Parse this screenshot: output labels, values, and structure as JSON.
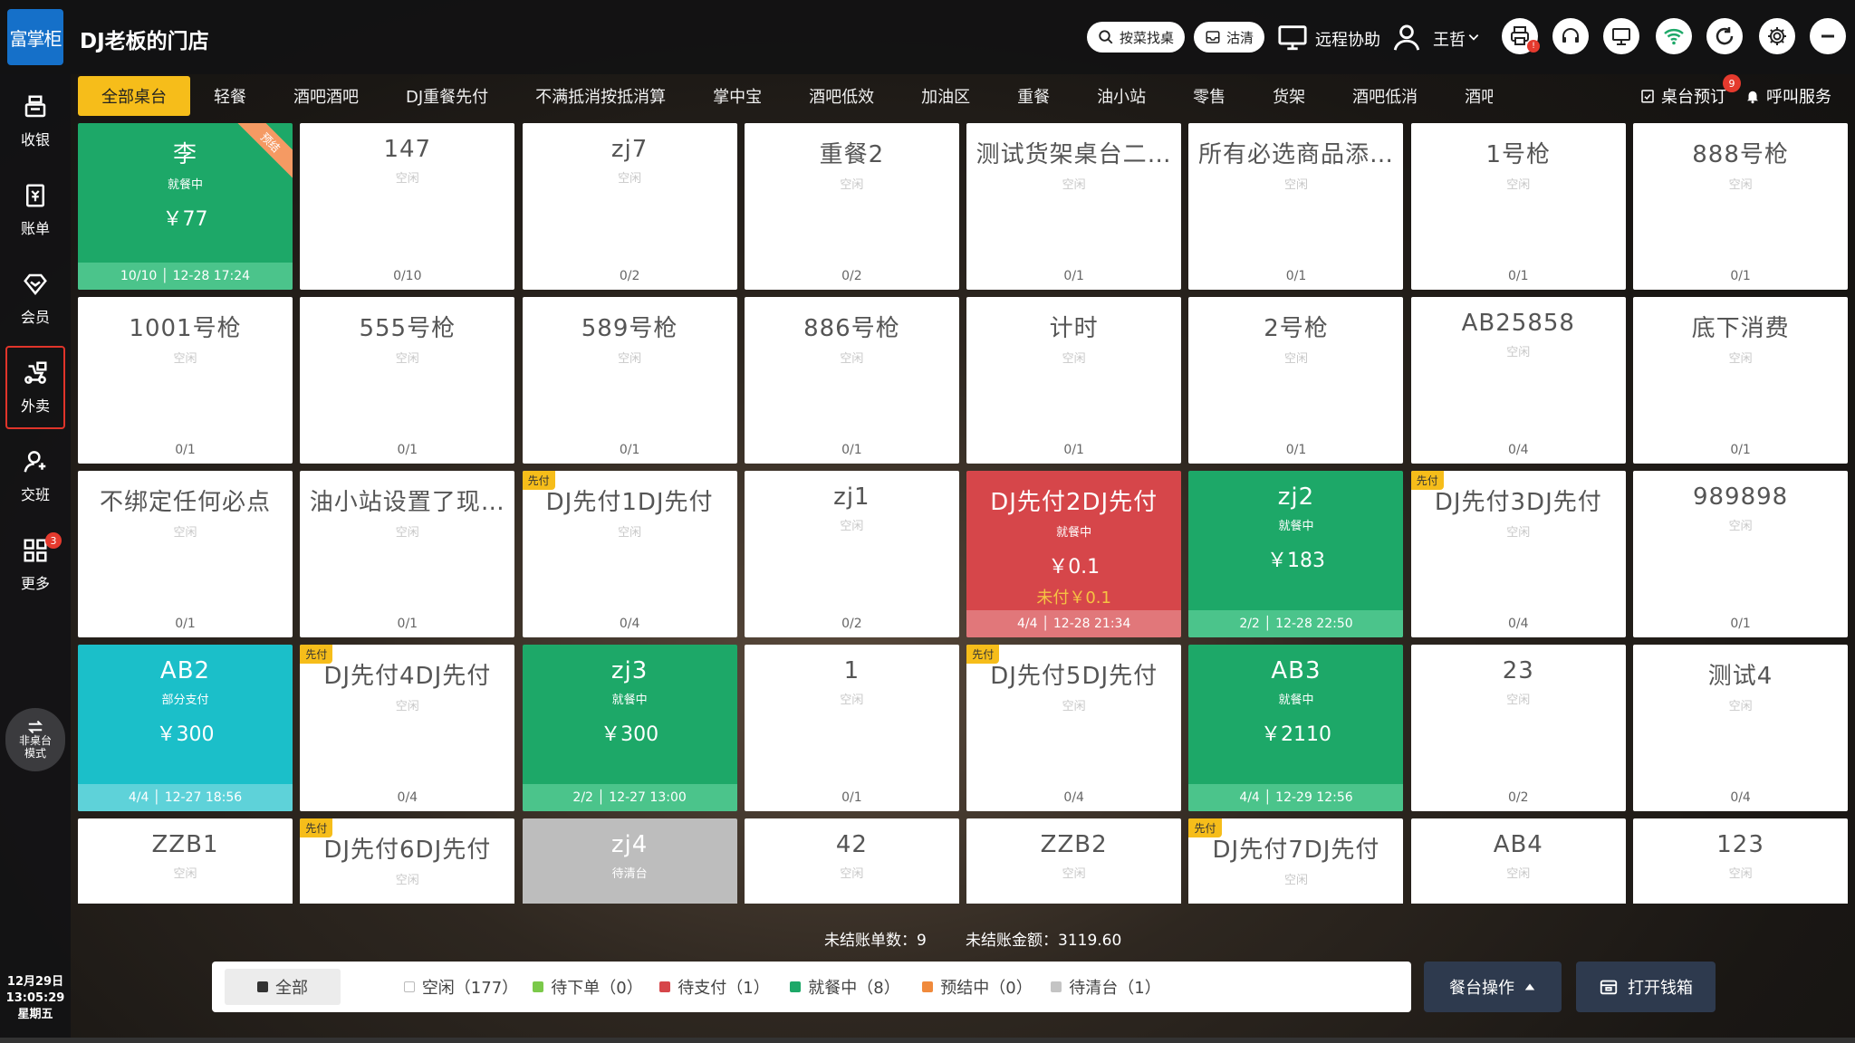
{
  "header": {
    "logo_text": "富掌柜",
    "store_name": "DJ老板的门店",
    "search_dish_label": "按菜找桌",
    "clean_label": "沽清",
    "remote_label": "远程协助",
    "user_name": "王哲",
    "print_badge": "!"
  },
  "sidebar": {
    "items": [
      {
        "label": "收银",
        "icon": "register-icon"
      },
      {
        "label": "账单",
        "icon": "bill-icon"
      },
      {
        "label": "会员",
        "icon": "member-icon"
      },
      {
        "label": "外卖",
        "icon": "delivery-icon"
      },
      {
        "label": "交班",
        "icon": "shift-icon"
      },
      {
        "label": "更多",
        "icon": "grid-icon",
        "badge": "3"
      }
    ],
    "active_index": 3,
    "mode_button": "非桌台模式",
    "date": "12月29日",
    "time": "13:05:29",
    "weekday": "星期五"
  },
  "tabs": {
    "items": [
      "全部桌台",
      "轻餐",
      "酒吧酒吧",
      "DJ重餐先付",
      "不满抵消按抵消算",
      "掌中宝",
      "酒吧低效",
      "加油区",
      "重餐",
      "油小站",
      "零售",
      "货架",
      "酒吧低消",
      "酒吧无论"
    ],
    "active_index": 0,
    "reserve_label": "桌台预订",
    "reserve_badge": "9",
    "call_label": "呼叫服务"
  },
  "tables": [
    {
      "name": "李",
      "status": "就餐中",
      "amount": "￥77",
      "foot": "10/10 │ 12-28 17:24",
      "color": "green",
      "ribbon": "预结"
    },
    {
      "name": "147",
      "status": "空闲",
      "foot": "0/10"
    },
    {
      "name": "zj7",
      "status": "空闲",
      "foot": "0/2"
    },
    {
      "name": "重餐2",
      "status": "空闲",
      "foot": "0/2"
    },
    {
      "name": "测试货架桌台二…",
      "status": "空闲",
      "foot": "0/1"
    },
    {
      "name": "所有必选商品添…",
      "status": "空闲",
      "foot": "0/1"
    },
    {
      "name": "1号枪",
      "status": "空闲",
      "foot": "0/1"
    },
    {
      "name": "888号枪",
      "status": "空闲",
      "foot": "0/1"
    },
    {
      "name": "1001号枪",
      "status": "空闲",
      "foot": "0/1"
    },
    {
      "name": "555号枪",
      "status": "空闲",
      "foot": "0/1"
    },
    {
      "name": "589号枪",
      "status": "空闲",
      "foot": "0/1"
    },
    {
      "name": "886号枪",
      "status": "空闲",
      "foot": "0/1"
    },
    {
      "name": "计时",
      "status": "空闲",
      "foot": "0/1"
    },
    {
      "name": "2号枪",
      "status": "空闲",
      "foot": "0/1"
    },
    {
      "name": "AB25858",
      "status": "空闲",
      "foot": "0/4"
    },
    {
      "name": "底下消费",
      "status": "空闲",
      "foot": "0/1"
    },
    {
      "name": "不绑定任何必点",
      "status": "空闲",
      "foot": "0/1"
    },
    {
      "name": "油小站设置了现…",
      "status": "空闲",
      "foot": "0/1"
    },
    {
      "name": "DJ先付1DJ先付",
      "status": "空闲",
      "foot": "0/4",
      "prepay": "先付"
    },
    {
      "name": "zj1",
      "status": "空闲",
      "foot": "0/2"
    },
    {
      "name": "DJ先付2DJ先付",
      "status": "就餐中",
      "amount": "￥0.1",
      "unpaid": "未付￥0.1",
      "foot": "4/4 │ 12-28 21:34",
      "color": "red"
    },
    {
      "name": "zj2",
      "status": "就餐中",
      "amount": "￥183",
      "foot": "2/2 │ 12-28 22:50",
      "color": "green"
    },
    {
      "name": "DJ先付3DJ先付",
      "status": "空闲",
      "foot": "0/4",
      "prepay": "先付"
    },
    {
      "name": "989898",
      "status": "空闲",
      "foot": "0/1"
    },
    {
      "name": "AB2",
      "status": "部分支付",
      "amount": "￥300",
      "foot": "4/4 │ 12-27 18:56",
      "color": "teal"
    },
    {
      "name": "DJ先付4DJ先付",
      "status": "空闲",
      "foot": "0/4",
      "prepay": "先付"
    },
    {
      "name": "zj3",
      "status": "就餐中",
      "amount": "￥300",
      "foot": "2/2 │ 12-27 13:00",
      "color": "green"
    },
    {
      "name": "1",
      "status": "空闲",
      "foot": "0/1"
    },
    {
      "name": "DJ先付5DJ先付",
      "status": "空闲",
      "foot": "0/4",
      "prepay": "先付"
    },
    {
      "name": "AB3",
      "status": "就餐中",
      "amount": "￥2110",
      "foot": "4/4 │ 12-29 12:56",
      "color": "green"
    },
    {
      "name": "23",
      "status": "空闲",
      "foot": "0/2"
    },
    {
      "name": "测试4",
      "status": "空闲",
      "foot": "0/4"
    },
    {
      "name": "ZZB1",
      "status": "空闲",
      "foot": ""
    },
    {
      "name": "DJ先付6DJ先付",
      "status": "空闲",
      "foot": "",
      "prepay": "先付"
    },
    {
      "name": "zj4",
      "status": "待清台",
      "foot": "",
      "color": "grey"
    },
    {
      "name": "42",
      "status": "空闲",
      "foot": ""
    },
    {
      "name": "ZZB2",
      "status": "空闲",
      "foot": ""
    },
    {
      "name": "DJ先付7DJ先付",
      "status": "空闲",
      "foot": "",
      "prepay": "先付"
    },
    {
      "name": "AB4",
      "status": "空闲",
      "foot": ""
    },
    {
      "name": "123",
      "status": "空闲",
      "foot": ""
    }
  ],
  "summary": {
    "unsettled_count": "未结账单数：9",
    "unsettled_amount": "未结账金额：3119.60"
  },
  "filters": [
    {
      "label": "全部",
      "color": "#333333"
    },
    {
      "label": "空闲（177）",
      "color": "#ffffff"
    },
    {
      "label": "待下单（0）",
      "color": "#7bc94a"
    },
    {
      "label": "待支付（1）",
      "color": "#d6464a"
    },
    {
      "label": "就餐中（8）",
      "color": "#1da868"
    },
    {
      "label": "预结中（0）",
      "color": "#f08a3c"
    },
    {
      "label": "待清台（1）",
      "color": "#c4c4c4"
    }
  ],
  "bottom": {
    "table_ops_label": "餐台操作",
    "open_cashbox_label": "打开钱箱"
  },
  "colors": {
    "accent": "#f6bd1a",
    "dining": "#1da868",
    "unpaid": "#d6464a",
    "partial": "#1bbfc9",
    "to_clean": "#bdbdbd"
  }
}
